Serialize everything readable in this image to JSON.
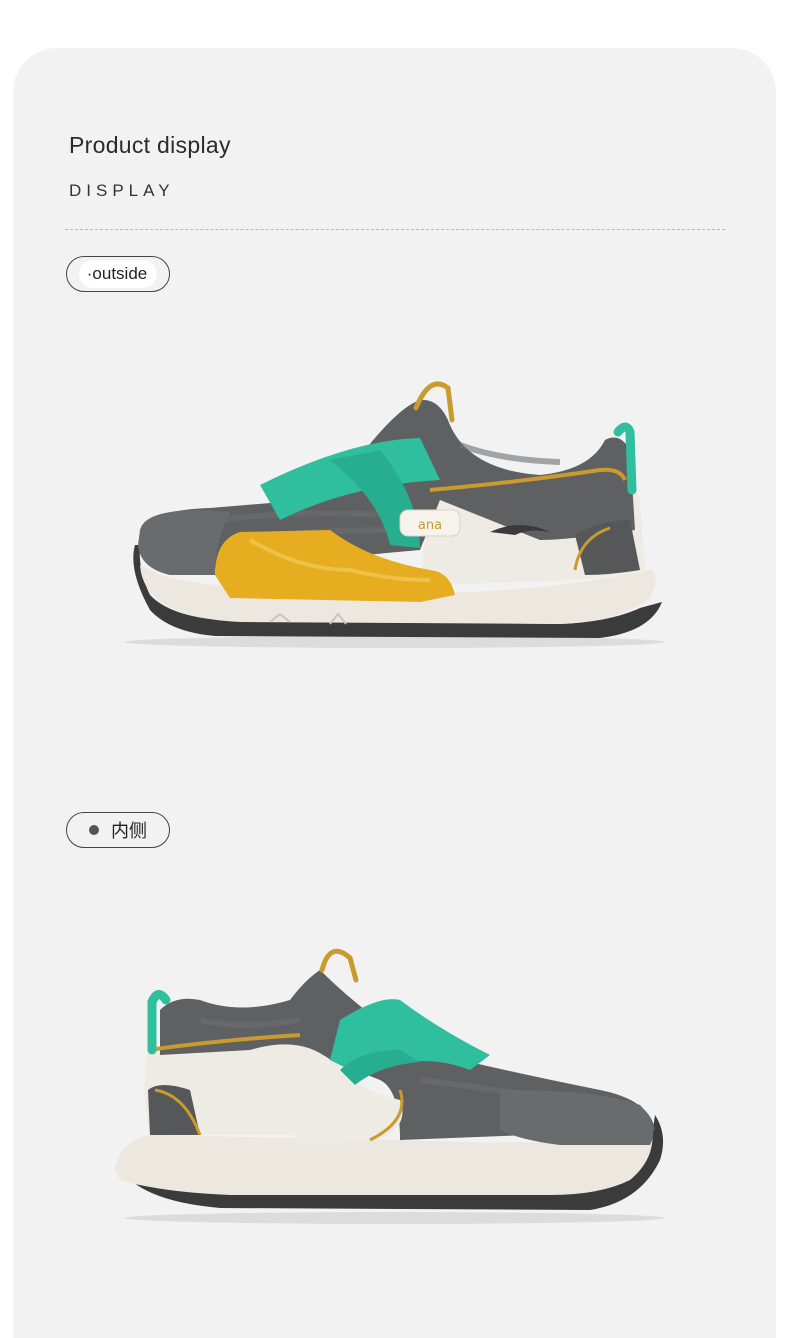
{
  "header": {
    "title": "Product display",
    "subtitle": "DISPLAY"
  },
  "views": {
    "outside_label": "·outside",
    "inside_label": "内侧"
  },
  "colors": {
    "background": "#f2f2f2",
    "mesh_gray": "#5f6062",
    "teal_strap": "#2fbf9f",
    "yellow_panel": "#e5ad1f",
    "white_panel": "#efece5",
    "mustard_trim": "#c99a2e"
  },
  "images": {
    "shoe_outside": "sneaker-outer-view",
    "shoe_inside": "sneaker-inner-view"
  }
}
